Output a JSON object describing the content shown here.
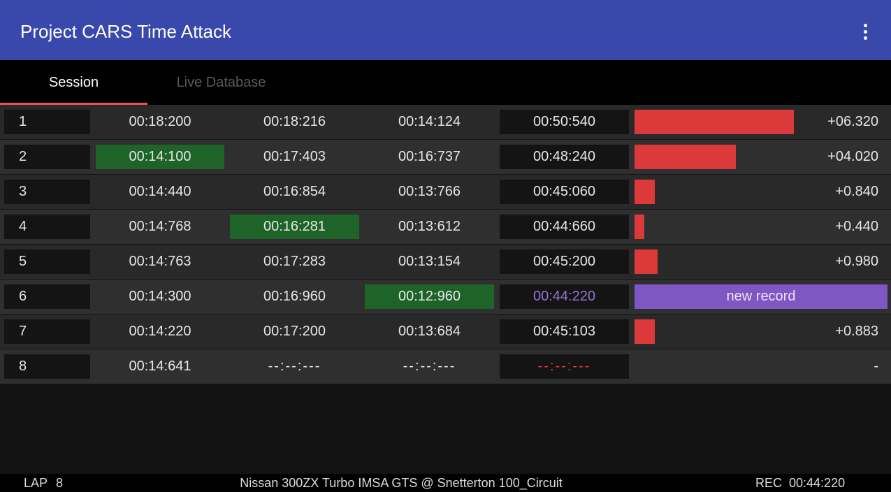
{
  "app": {
    "title": "Project CARS Time Attack",
    "accent": "#3949ab"
  },
  "tabs": [
    {
      "label": "Session",
      "active": true
    },
    {
      "label": "Live Database",
      "active": false
    }
  ],
  "colors": {
    "best_sector": "#1e6428",
    "slower_bar": "#dc3a3a",
    "record": "#7e57c2"
  },
  "laps": [
    {
      "lap": "1",
      "s1": "00:18:200",
      "s2": "00:18:216",
      "s3": "00:14:124",
      "total": "00:50:540",
      "delta": "+06.320",
      "bar_fraction": 0.63
    },
    {
      "lap": "2",
      "s1": "00:14:100",
      "s2": "00:17:403",
      "s3": "00:16:737",
      "total": "00:48:240",
      "delta": "+04.020",
      "bar_fraction": 0.4,
      "best": "s1"
    },
    {
      "lap": "3",
      "s1": "00:14:440",
      "s2": "00:16:854",
      "s3": "00:13:766",
      "total": "00:45:060",
      "delta": "+0.840",
      "bar_fraction": 0.08
    },
    {
      "lap": "4",
      "s1": "00:14:768",
      "s2": "00:16:281",
      "s3": "00:13:612",
      "total": "00:44:660",
      "delta": "+0.440",
      "bar_fraction": 0.04,
      "best": "s2"
    },
    {
      "lap": "5",
      "s1": "00:14:763",
      "s2": "00:17:283",
      "s3": "00:13:154",
      "total": "00:45:200",
      "delta": "+0.980",
      "bar_fraction": 0.09
    },
    {
      "lap": "6",
      "s1": "00:14:300",
      "s2": "00:16:960",
      "s3": "00:12:960",
      "total": "00:44:220",
      "record_label": "new record",
      "best": "s3"
    },
    {
      "lap": "7",
      "s1": "00:14:220",
      "s2": "00:17:200",
      "s3": "00:13:684",
      "total": "00:45:103",
      "delta": "+0.883",
      "bar_fraction": 0.08
    },
    {
      "lap": "8",
      "s1": "00:14:641",
      "s2": "--:--:---",
      "s3": "--:--:---",
      "total": "--:--:---",
      "delta": "-",
      "in_progress": true
    }
  ],
  "status": {
    "lap_label": "LAP",
    "lap_value": "8",
    "car_track": "Nissan 300ZX Turbo IMSA GTS @ Snetterton 100_Circuit",
    "rec_label": "REC",
    "rec_value": "00:44:220"
  }
}
